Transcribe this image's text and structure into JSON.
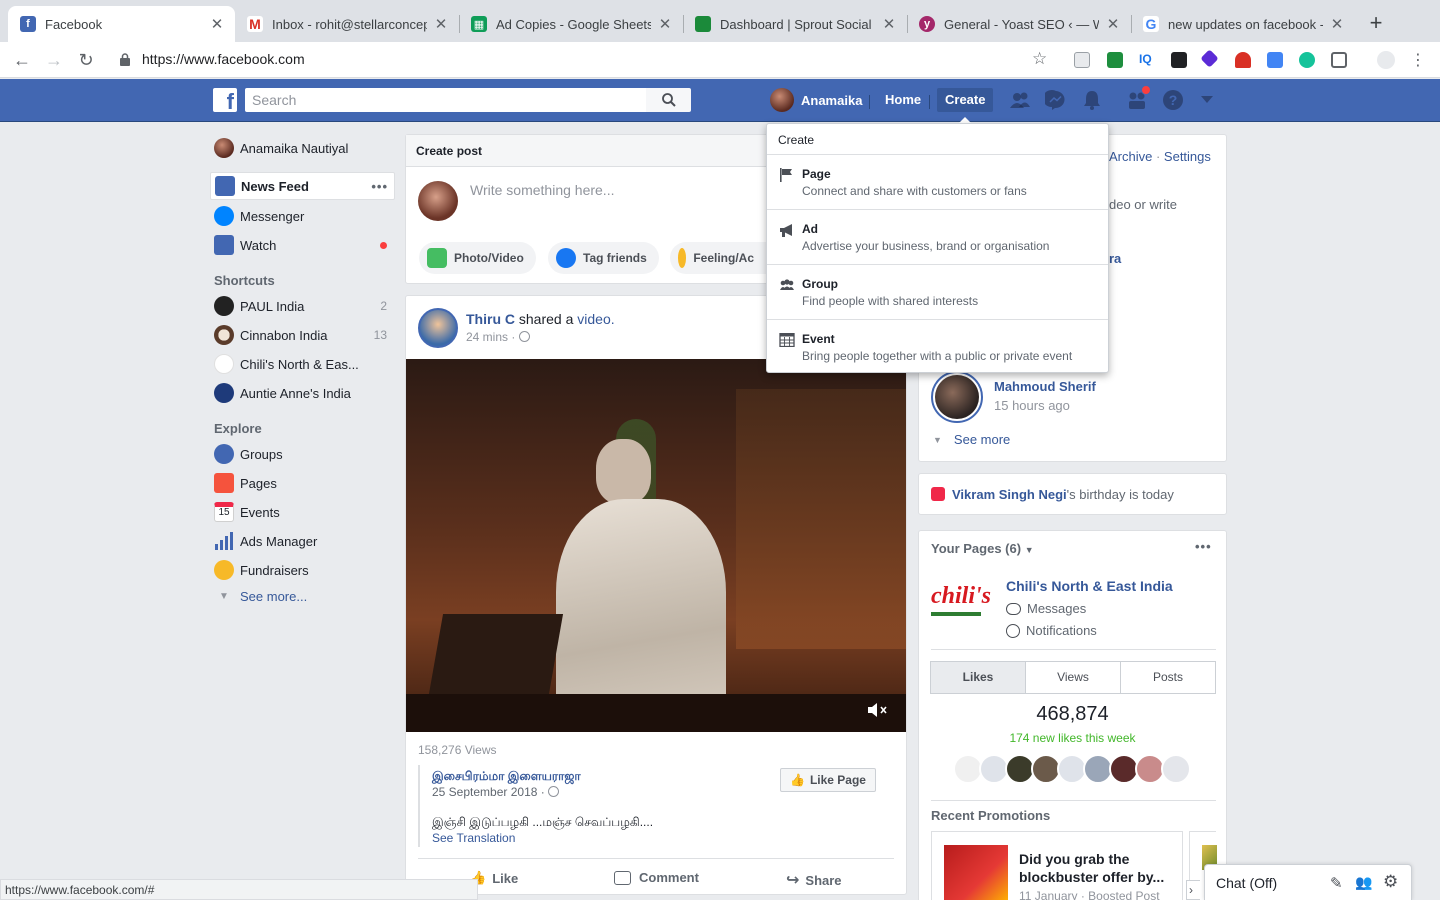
{
  "browser": {
    "tabs": [
      {
        "title": "Facebook",
        "icon": "facebook-icon",
        "color": "#4267b2",
        "glyph": "f"
      },
      {
        "title": "Inbox - rohit@stellarconcept",
        "icon": "gmail-icon",
        "color": "#d93025",
        "glyph": "M"
      },
      {
        "title": "Ad Copies - Google Sheets",
        "icon": "sheets-icon",
        "color": "#0f9d58",
        "glyph": "▦"
      },
      {
        "title": "Dashboard | Sprout Social",
        "icon": "sprout-icon",
        "color": "#1b8a3a",
        "glyph": "▰"
      },
      {
        "title": "General - Yoast SEO ‹ — Wo",
        "icon": "yoast-icon",
        "color": "#a4286a",
        "glyph": "y"
      },
      {
        "title": "new updates on facebook -",
        "icon": "google-icon",
        "color": "#4285f4",
        "glyph": "G"
      }
    ],
    "url": "https://www.facebook.com",
    "status_url": "https://www.facebook.com/#"
  },
  "fb": {
    "search_placeholder": "Search",
    "user": "Anamaika",
    "nav": {
      "home": "Home",
      "create": "Create"
    }
  },
  "left": {
    "profile": "Anamaika Nautiyal",
    "main": [
      {
        "label": "News Feed",
        "icon": "news-feed-icon"
      },
      {
        "label": "Messenger",
        "icon": "messenger-icon"
      },
      {
        "label": "Watch",
        "icon": "watch-icon"
      }
    ],
    "more_dots": "•••",
    "shortcuts_heading": "Shortcuts",
    "shortcuts": [
      {
        "label": "PAUL India",
        "count": "2"
      },
      {
        "label": "Cinnabon India",
        "count": "13"
      },
      {
        "label": "Chili's North & Eas...",
        "count": ""
      },
      {
        "label": "Auntie Anne's India",
        "count": ""
      }
    ],
    "explore_heading": "Explore",
    "explore": [
      {
        "label": "Groups",
        "icon": "groups-icon"
      },
      {
        "label": "Pages",
        "icon": "pages-icon"
      },
      {
        "label": "Events",
        "icon": "events-icon",
        "glyph": "15"
      },
      {
        "label": "Ads Manager",
        "icon": "ads-manager-icon"
      },
      {
        "label": "Fundraisers",
        "icon": "fundraisers-icon"
      }
    ],
    "see_more": "See more..."
  },
  "create_post": {
    "heading": "Create post",
    "placeholder": "Write something here...",
    "pills": {
      "photo": "Photo/Video",
      "tag": "Tag friends",
      "feeling": "Feeling/Ac"
    }
  },
  "post": {
    "author": "Thiru C",
    "action": " shared a ",
    "object": "video.",
    "time": "24 mins ·",
    "views": "158,276 Views",
    "page_name": "இசைபிரம்மா இளையராஜா",
    "page_date": "25 September 2018 ·",
    "like_page": "Like Page",
    "text": "இஞ்சி இடுப்பழகி ...மஞ்ச செவப்பழகி....",
    "see_translation": "See Translation",
    "actions": {
      "like": "Like",
      "comment": "Comment",
      "share": "Share"
    }
  },
  "create_menu": {
    "heading": "Create",
    "items": [
      {
        "title": "Page",
        "desc": "Connect and share with customers or fans",
        "icon": "flag-icon"
      },
      {
        "title": "Ad",
        "desc": "Advertise your business, brand or organisation",
        "icon": "megaphone-icon"
      },
      {
        "title": "Group",
        "desc": "Find people with shared interests",
        "icon": "group-icon"
      },
      {
        "title": "Event",
        "desc": "Bring people together with a public or private event",
        "icon": "calendar-icon"
      }
    ]
  },
  "right": {
    "stories": {
      "archive": "Archive",
      "sep": " · ",
      "settings": "Settings",
      "partial1": "deo or write",
      "partial2": "ra",
      "person": "Mahmoud Sherif",
      "time": "15 hours ago",
      "see_more": "See more"
    },
    "birthday": {
      "name": "Vikram Singh Negi",
      "text": "'s birthday is today"
    },
    "pages": {
      "heading": "Your Pages (6)",
      "page_name": "Chili's North & East India",
      "messages": "Messages",
      "notifications": "Notifications",
      "tabs": [
        "Likes",
        "Views",
        "Posts"
      ],
      "likes": "468,874",
      "new_likes": "174 new likes this week",
      "promotions_heading": "Recent Promotions",
      "promo_title": "Did you grab the blockbuster offer by...",
      "promo_meta": "11 January · Boosted Post"
    },
    "chat": "Chat (Off)"
  }
}
